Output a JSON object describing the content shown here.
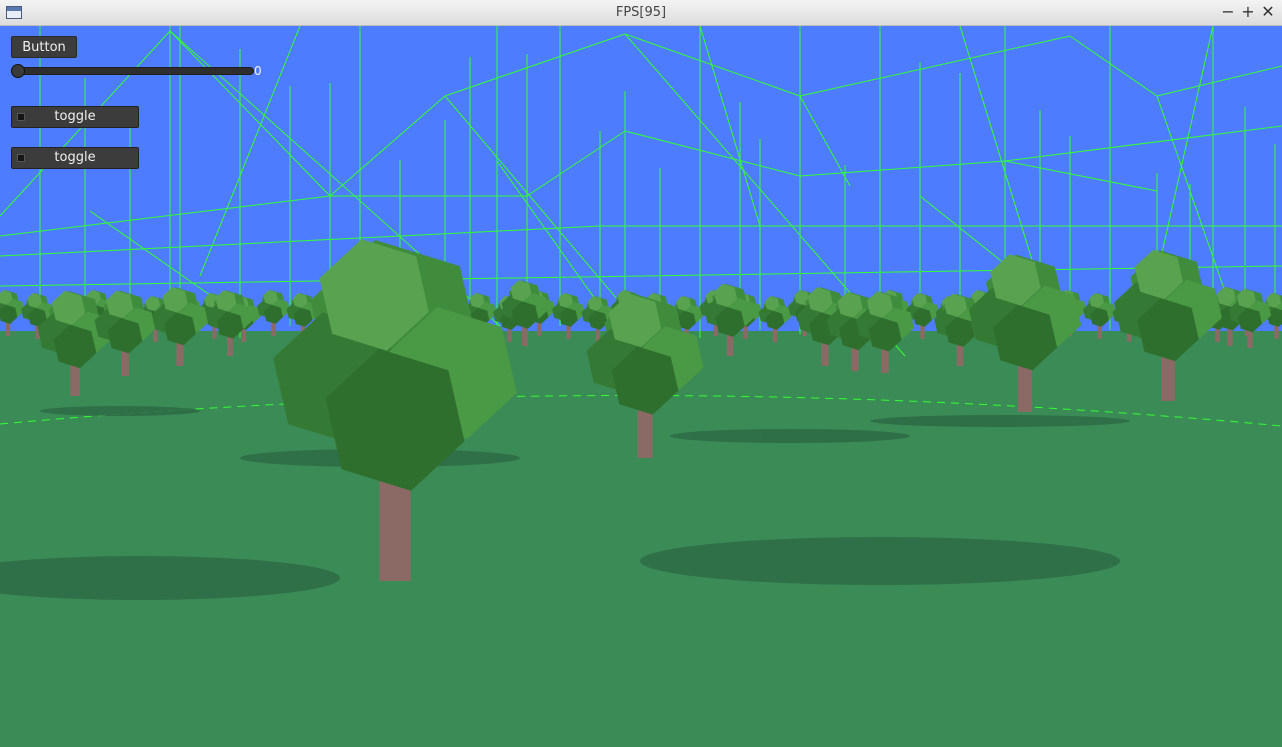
{
  "window": {
    "title": "FPS[95]",
    "app_icon": "window-icon",
    "minimize_glyph": "−",
    "maximize_glyph": "+",
    "close_glyph": "✕"
  },
  "gui": {
    "button_label": "Button",
    "slider_value": "0",
    "slider_fraction": 0,
    "toggles": [
      {
        "label": "toggle",
        "checked": false
      },
      {
        "label": "toggle",
        "checked": false
      }
    ]
  },
  "scene": {
    "sky_color": "#4d7cff",
    "ground_color": "#3b8b57",
    "wireframe_color": "#33ff33",
    "trunk_color": "#8b6a66",
    "foliage_color": "#3f8c3d"
  }
}
